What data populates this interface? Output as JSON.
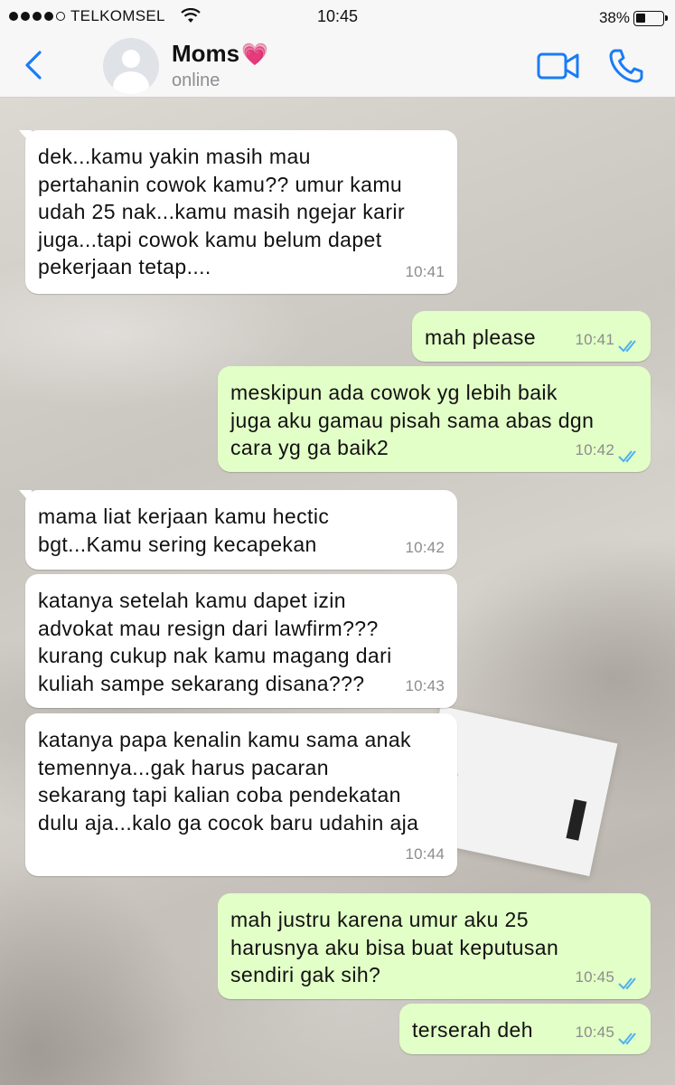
{
  "status_bar": {
    "carrier": "TELKOMSEL",
    "time": "10:45",
    "battery_percent": "38%",
    "battery_level": 0.38
  },
  "header": {
    "contact_name": "Moms",
    "contact_emoji": "💗",
    "status": "online"
  },
  "colors": {
    "accent": "#1a7cf5",
    "incoming_bubble": "#ffffff",
    "outgoing_bubble": "#e2ffc7",
    "read_ticks": "#4fb1ee"
  },
  "messages": [
    {
      "direction": "incoming",
      "text": "dek...kamu yakin masih mau\npertahanin cowok kamu?? umur kamu\nudah 25 nak...kamu masih ngejar karir\njuga...tapi cowok kamu belum dapet\npekerjaan tetap....",
      "time": "10:41"
    },
    {
      "direction": "outgoing",
      "text": "mah please",
      "time": "10:41",
      "status": "read"
    },
    {
      "direction": "outgoing",
      "text": "meskipun ada cowok yg lebih baik\njuga aku gamau pisah sama abas dgn\ncara yg ga baik2",
      "time": "10:42",
      "status": "read"
    },
    {
      "direction": "incoming",
      "text": "mama liat kerjaan kamu hectic\nbgt...Kamu sering kecapekan",
      "time": "10:42"
    },
    {
      "direction": "incoming",
      "text": "katanya setelah kamu dapet izin\nadvokat mau resign dari lawfirm???\nkurang cukup nak kamu magang dari\nkuliah sampe sekarang disana???",
      "time": "10:43"
    },
    {
      "direction": "incoming",
      "text": "katanya papa kenalin kamu sama anak\ntemennya...gak harus pacaran\nsekarang tapi kalian coba pendekatan\ndulu aja...kalo ga cocok baru udahin aja",
      "time": "10:44"
    },
    {
      "direction": "outgoing",
      "text": "mah justru karena umur aku 25\nharusnya aku bisa buat keputusan\nsendiri gak sih?",
      "time": "10:45",
      "status": "read"
    },
    {
      "direction": "outgoing",
      "text": "terserah deh",
      "time": "10:45",
      "status": "read"
    }
  ]
}
